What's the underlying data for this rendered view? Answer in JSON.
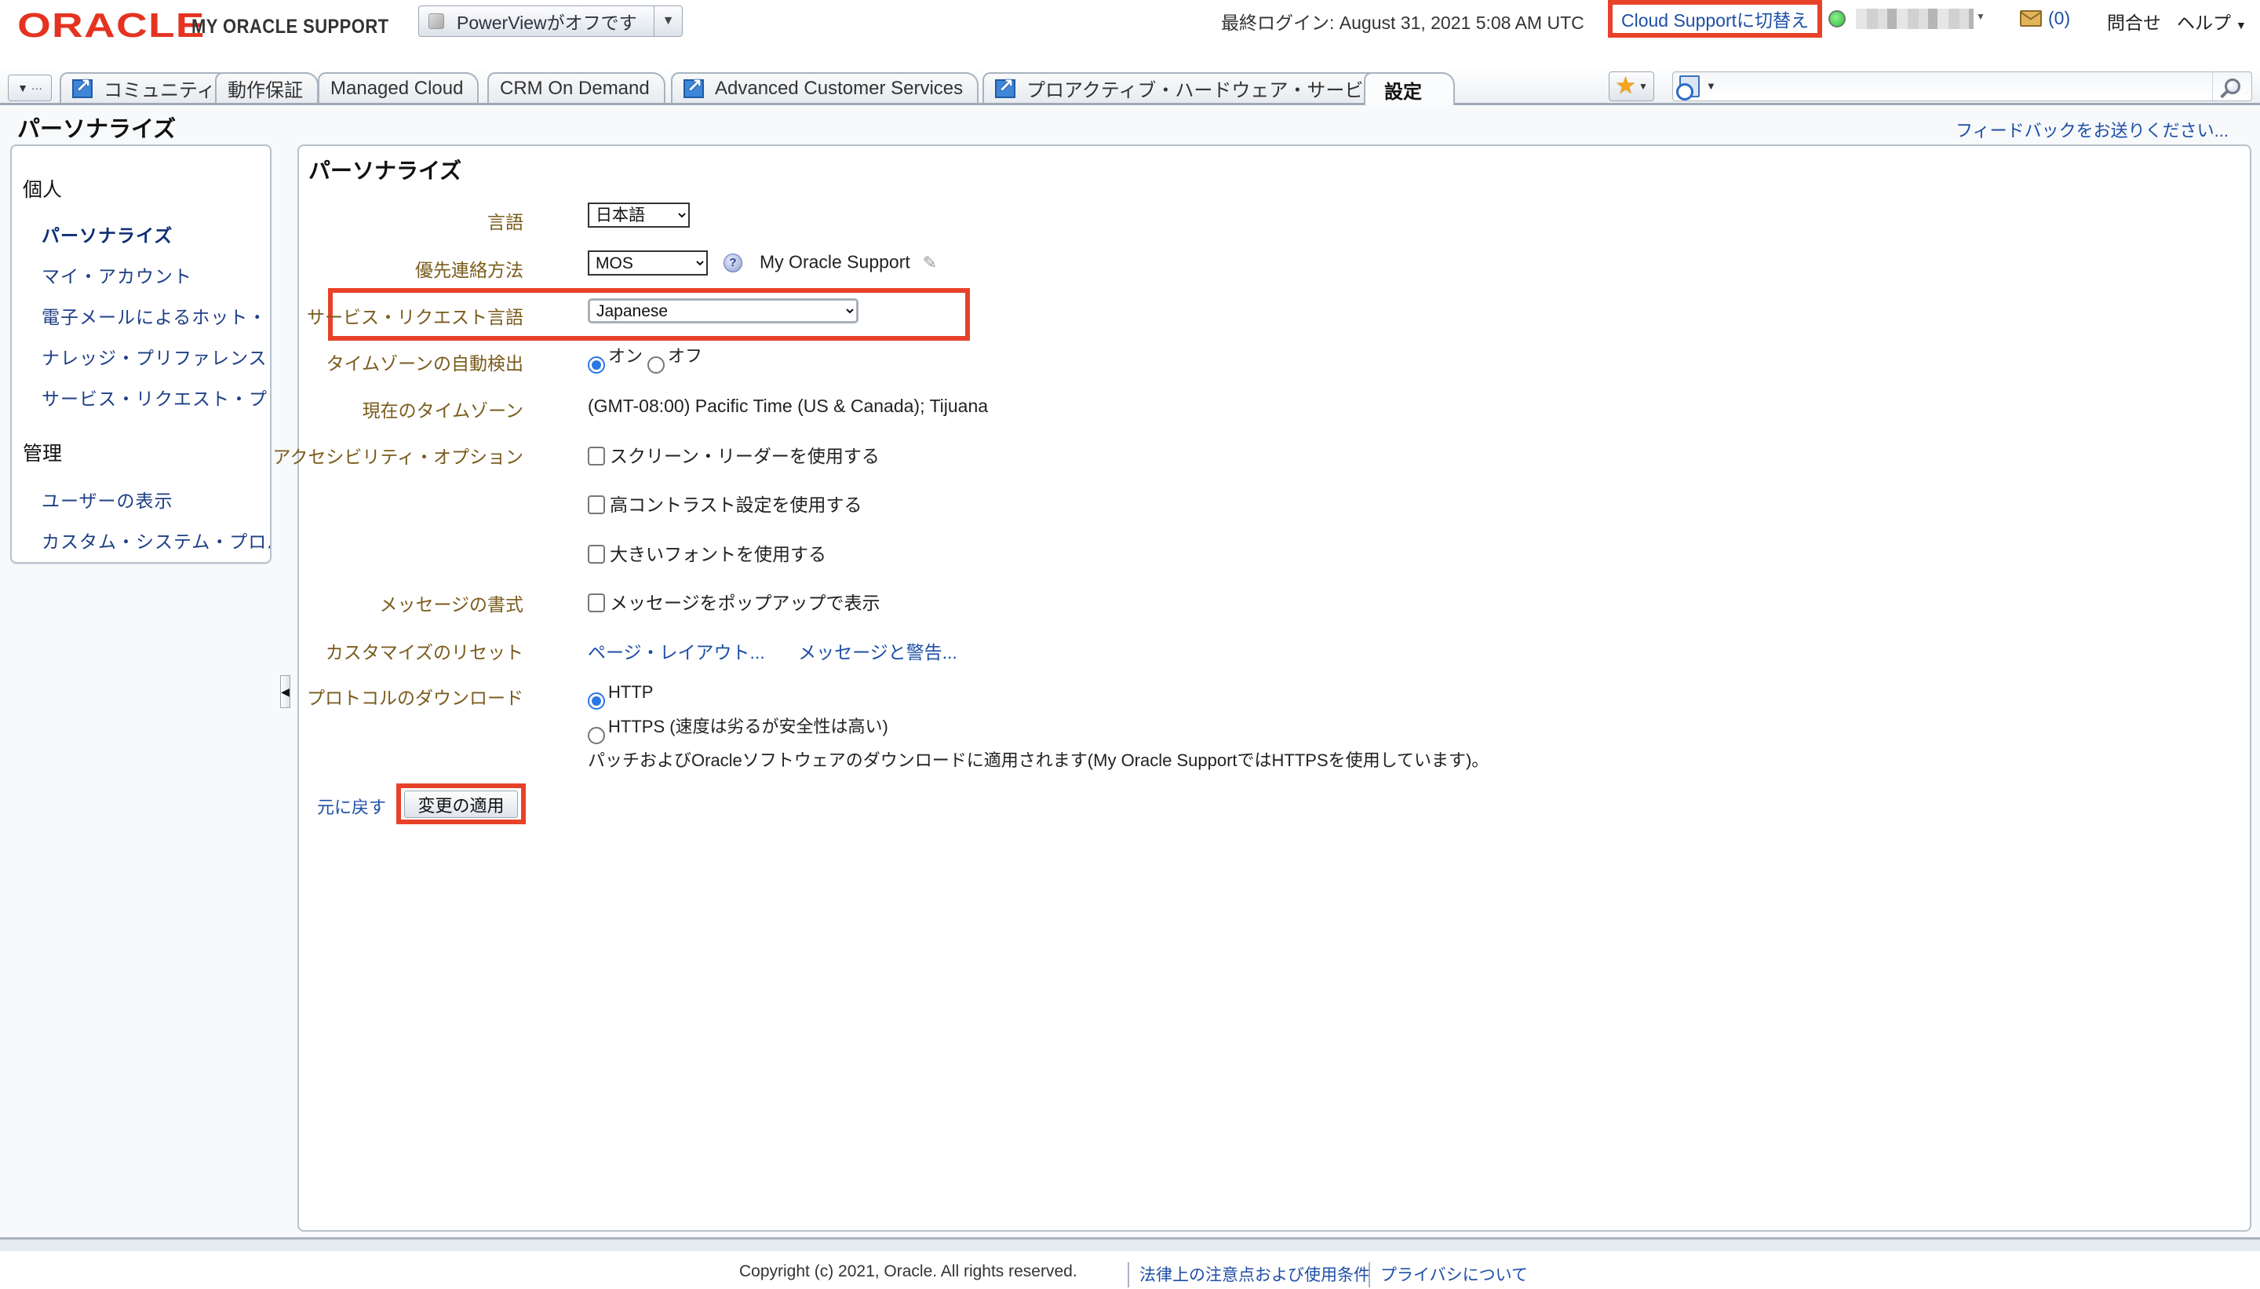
{
  "header": {
    "logo_brand": "ORACLE",
    "logo_product": "MY ORACLE SUPPORT",
    "powerview_label": "PowerViewがオフです",
    "last_login": "最終ログイン: August 31, 2021 5:08 AM UTC",
    "cloud_switch": "Cloud Supportに切替え",
    "mail_count": "(0)",
    "contact": "問合せ",
    "help": "ヘルプ"
  },
  "tabs": [
    {
      "label": "コミュニティ",
      "external": true,
      "active": false
    },
    {
      "label": "動作保証",
      "external": false,
      "active": false
    },
    {
      "label": "Managed Cloud",
      "external": false,
      "active": false
    },
    {
      "label": "CRM On Demand",
      "external": false,
      "active": false
    },
    {
      "label": "Advanced Customer Services",
      "external": true,
      "active": false
    },
    {
      "label": "プロアクティブ・ハードウェア・サービス",
      "external": true,
      "active": false
    },
    {
      "label": "設定",
      "external": false,
      "active": true
    }
  ],
  "search": {
    "placeholder": "",
    "value": ""
  },
  "page": {
    "title": "パーソナライズ",
    "feedback": "フィードバックをお送りください..."
  },
  "sidebar": {
    "sections": [
      {
        "title": "個人",
        "items": [
          {
            "label": "パーソナライズ",
            "active": true
          },
          {
            "label": "マイ・アカウント"
          },
          {
            "label": "電子メールによるホット・ト"
          },
          {
            "label": "ナレッジ・プリファレンス"
          },
          {
            "label": "サービス・リクエスト・プロ"
          }
        ]
      },
      {
        "title": "管理",
        "items": [
          {
            "label": "ユーザーの表示"
          },
          {
            "label": "カスタム・システム・プロパ"
          }
        ]
      }
    ]
  },
  "form": {
    "title": "パーソナライズ",
    "language": {
      "label": "言語",
      "value": "日本語"
    },
    "contact_method": {
      "label": "優先連絡方法",
      "value": "MOS",
      "display": "My Oracle Support"
    },
    "sr_language": {
      "label": "サービス・リクエスト言語",
      "value": "Japanese"
    },
    "tz_auto": {
      "label": "タイムゾーンの自動検出",
      "on": "オン",
      "off": "オフ",
      "selected": "on"
    },
    "tz_current": {
      "label": "現在のタイムゾーン",
      "value": "(GMT-08:00) Pacific Time (US & Canada); Tijuana"
    },
    "accessibility": {
      "label": "アクセシビリティ・オプション",
      "options": [
        {
          "label": "スクリーン・リーダーを使用する",
          "checked": false
        },
        {
          "label": "高コントラスト設定を使用する",
          "checked": false
        },
        {
          "label": "大きいフォントを使用する",
          "checked": false
        }
      ]
    },
    "message_format": {
      "label": "メッセージの書式",
      "option": "メッセージをポップアップで表示",
      "checked": false
    },
    "reset": {
      "label": "カスタマイズのリセット",
      "page_layout": "ページ・レイアウト...",
      "messages": "メッセージと警告..."
    },
    "download_protocol": {
      "label": "プロトコルのダウンロード",
      "http": "HTTP",
      "https": "HTTPS (速度は劣るが安全性は高い)",
      "selected": "HTTP",
      "note": "パッチおよびOracleソフトウェアのダウンロードに適用されます(My Oracle SupportではHTTPSを使用しています)。"
    },
    "revert": "元に戻す",
    "apply": "変更の適用"
  },
  "footer": {
    "copyright": "Copyright (c) 2021, Oracle. All rights reserved.",
    "legal": "法律上の注意点および使用条件",
    "privacy": "プライバシについて"
  },
  "colors": {
    "highlight": "#e8412a",
    "link": "#1e4fa6",
    "label": "#7a5b1d",
    "oracle_red": "#e53321"
  }
}
